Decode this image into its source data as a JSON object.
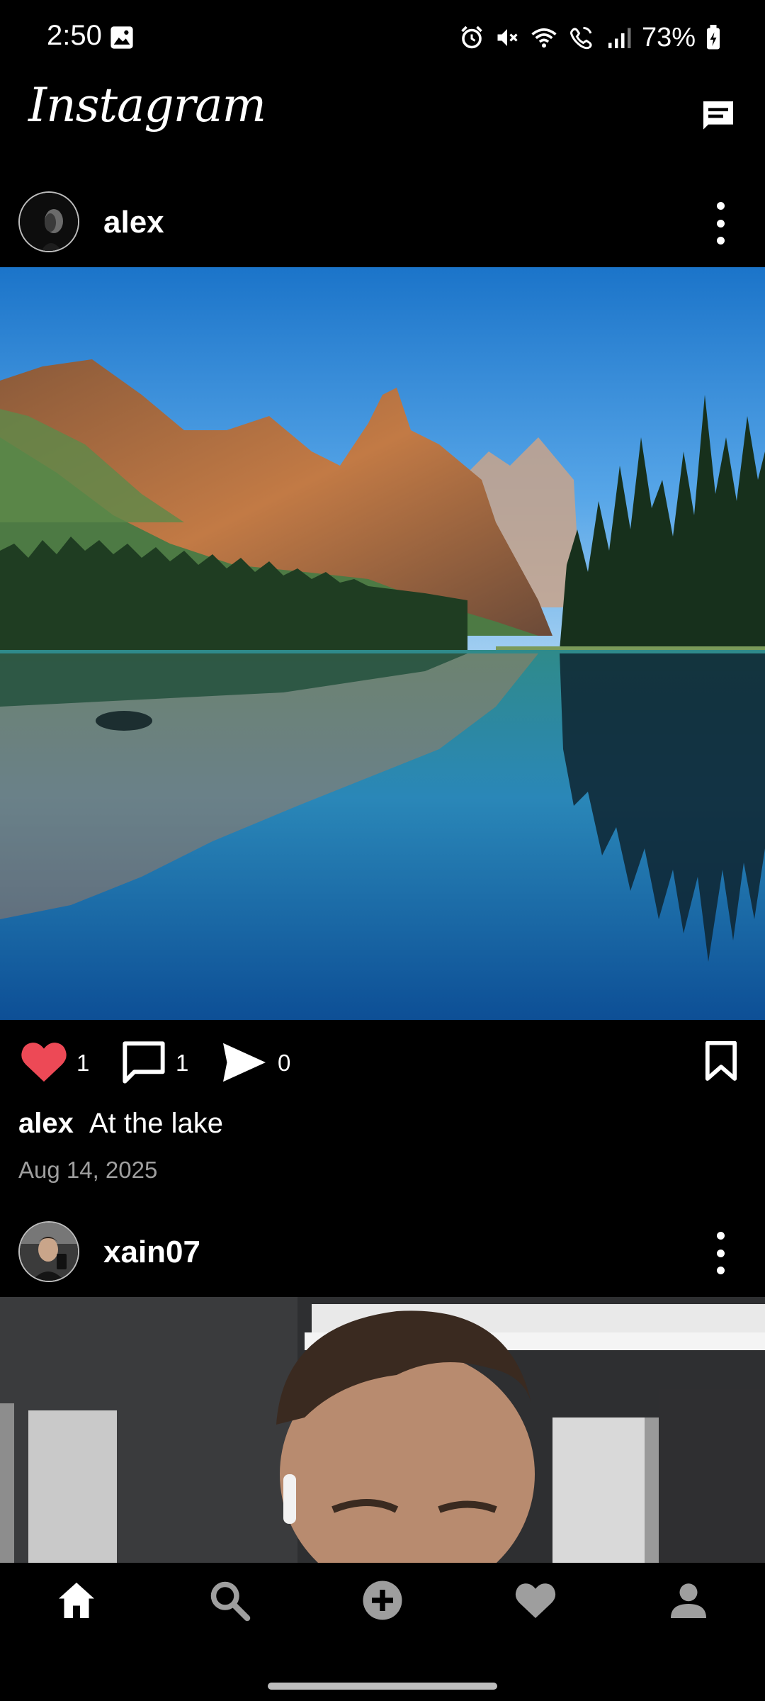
{
  "status_bar": {
    "time": "2:50",
    "battery": "73%",
    "icons": [
      "gallery-icon",
      "alarm-icon",
      "mute-icon",
      "wifi-icon",
      "wifi-calling-icon",
      "signal-icon",
      "battery-icon"
    ]
  },
  "header": {
    "logo_text": "Instagram",
    "messages_icon": "message-icon"
  },
  "posts": [
    {
      "username": "alex",
      "image_alt": "mountain lake",
      "likes": "1",
      "comments": "1",
      "shares": "0",
      "caption_user": "alex",
      "caption": "At the lake",
      "date": "Aug 14, 2025",
      "liked": true
    },
    {
      "username": "xain07"
    }
  ],
  "bottom_nav": {
    "items": [
      "home-icon",
      "search-icon",
      "add-icon",
      "heart-icon",
      "profile-icon"
    ],
    "active": "home-icon"
  },
  "colors": {
    "background": "#000000",
    "like_red": "#ed4956",
    "secondary_text": "#9e9e9e"
  }
}
